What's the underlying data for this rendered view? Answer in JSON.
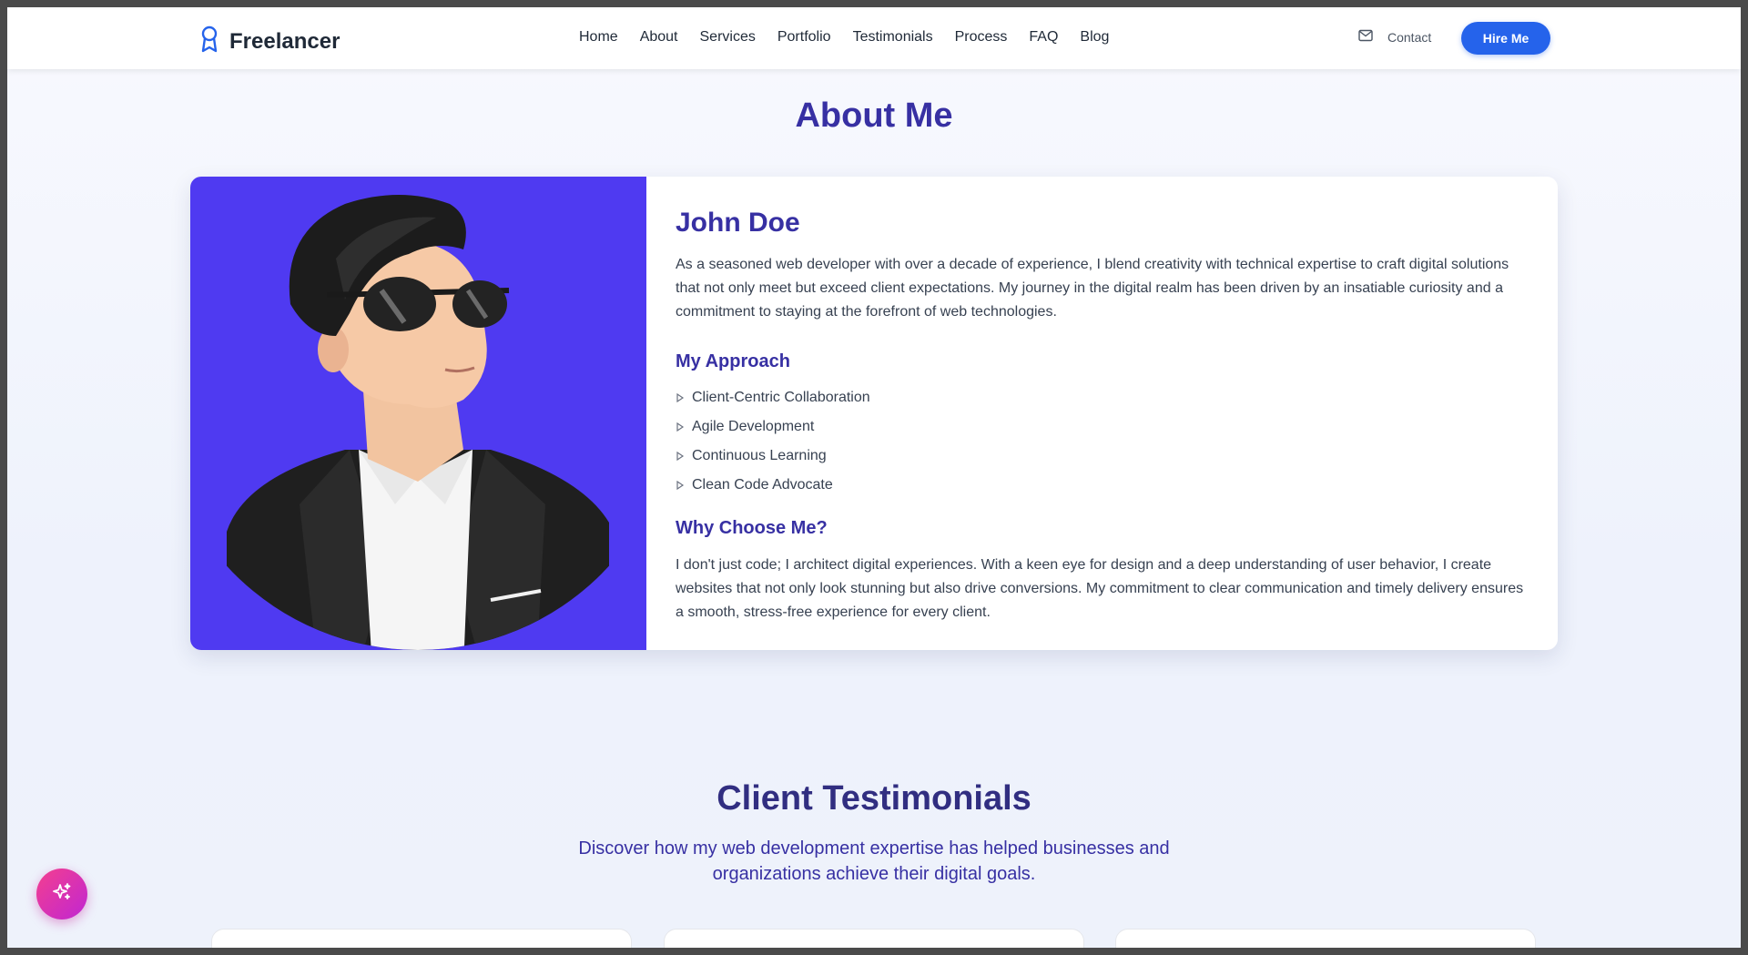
{
  "header": {
    "brand": "Freelancer",
    "nav": [
      "Home",
      "About",
      "Services",
      "Portfolio",
      "Testimonials",
      "Process",
      "FAQ",
      "Blog"
    ],
    "contact_label": "Contact",
    "hire_label": "Hire Me"
  },
  "about": {
    "title": "About Me",
    "name": "John Doe",
    "intro": "As a seasoned web developer with over a decade of experience, I blend creativity with technical expertise to craft digital solutions that not only meet but exceed client expectations. My journey in the digital realm has been driven by an insatiable curiosity and a commitment to staying at the forefront of web technologies.",
    "approach_title": "My Approach",
    "approach_items": [
      "Client-Centric Collaboration",
      "Agile Development",
      "Continuous Learning",
      "Clean Code Advocate"
    ],
    "why_title": "Why Choose Me?",
    "why_text": "I don't just code; I architect digital experiences. With a keen eye for design and a deep understanding of user behavior, I create websites that not only look stunning but also drive conversions. My commitment to clear communication and timely delivery ensures a smooth, stress-free experience for every client."
  },
  "testimonials": {
    "title": "Client Testimonials",
    "subtitle": "Discover how my web development expertise has helped businesses and organizations achieve their digital goals."
  },
  "icons": {
    "logo": "award-ribbon-icon",
    "contact": "mail-icon",
    "fab": "sparkles-icon"
  },
  "colors": {
    "accent": "#2563eb",
    "heading": "#3730a3",
    "photo_bg": "#4f3af1"
  }
}
